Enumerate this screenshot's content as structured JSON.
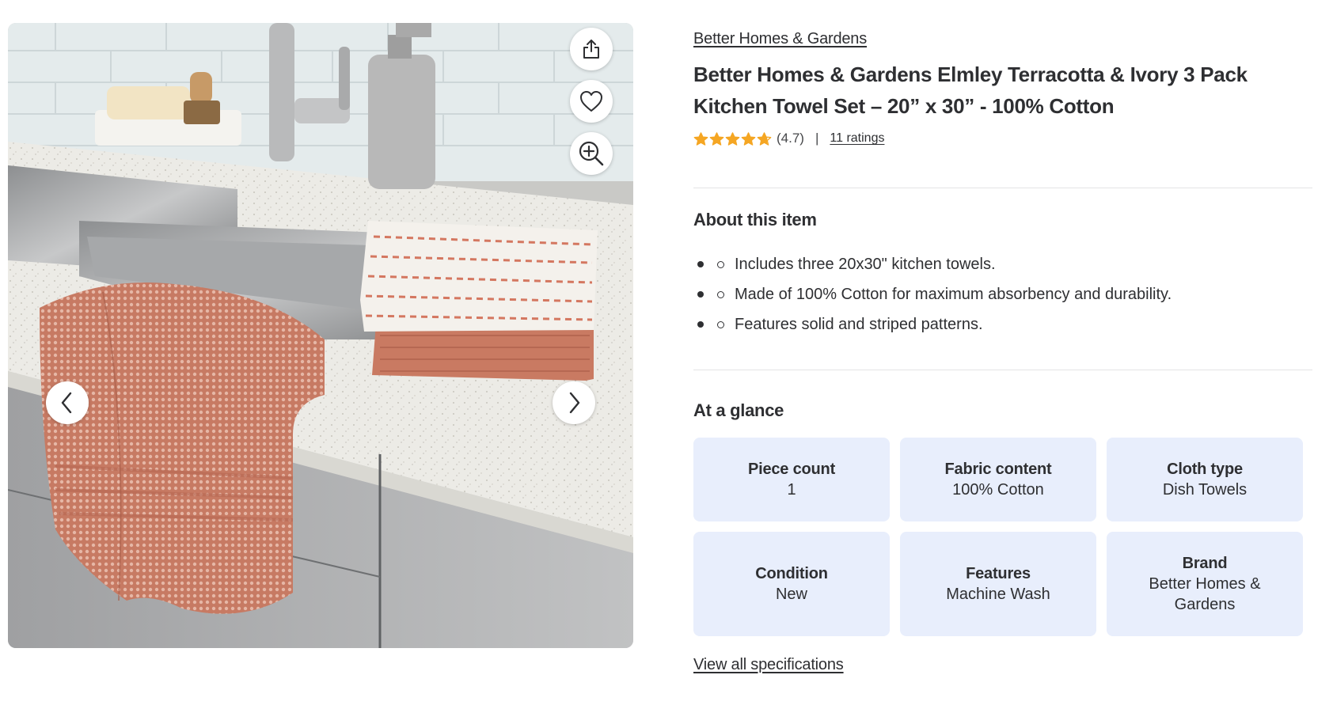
{
  "product": {
    "brand_link": "Better Homes & Gardens",
    "title": "Better Homes & Gardens Elmley Terracotta & Ivory 3 Pack Kitchen Towel Set – 20” x 30” - 100% Cotton",
    "rating": {
      "stars": 4.7,
      "value_text": "(4.7)",
      "separator": "|",
      "count_text": "11 ratings"
    }
  },
  "gallery": {
    "share_icon": "share-icon",
    "favorite_icon": "heart-icon",
    "zoom_icon": "zoom-in-icon",
    "prev_icon": "chevron-left-icon",
    "next_icon": "chevron-right-icon"
  },
  "about": {
    "heading": "About this item",
    "bullets": [
      "Includes three 20x30\" kitchen towels.",
      "Made of 100% Cotton for maximum absorbency and durability.",
      "Features solid and striped patterns."
    ]
  },
  "glance": {
    "heading": "At a glance",
    "cards": [
      {
        "label": "Piece count",
        "value": "1"
      },
      {
        "label": "Fabric content",
        "value": "100% Cotton"
      },
      {
        "label": "Cloth type",
        "value": "Dish Towels"
      },
      {
        "label": "Condition",
        "value": "New"
      },
      {
        "label": "Features",
        "value": "Machine Wash"
      },
      {
        "label": "Brand",
        "value": "Better Homes & Gardens"
      }
    ],
    "view_all": "View all specifications"
  },
  "colors": {
    "star": "#f5a623",
    "card_bg": "#e8eefc",
    "text": "#2e2f32",
    "towel_terracotta": "#c97a62",
    "towel_ivory": "#f4f1ec"
  }
}
